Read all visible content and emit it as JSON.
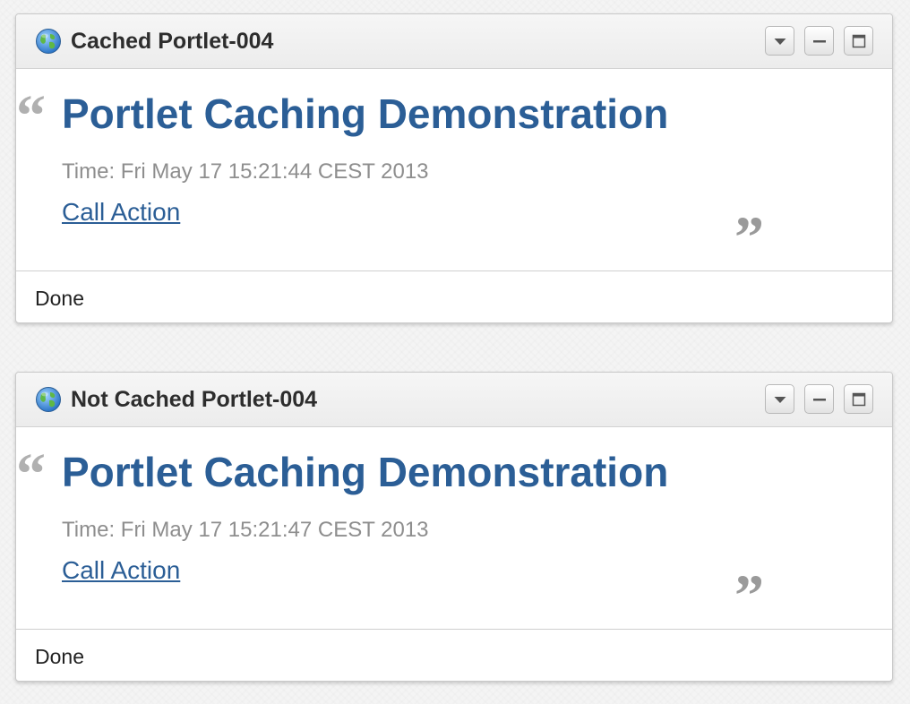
{
  "portlets": [
    {
      "title": "Cached Portlet-004",
      "icon": "globe-icon",
      "controls": [
        "dropdown-icon",
        "minimize-icon",
        "maximize-icon"
      ],
      "heading": "Portlet Caching Demonstration",
      "time": "Time: Fri May 17 15:21:44 CEST 2013",
      "action_label": "Call Action",
      "status": "Done"
    },
    {
      "title": "Not Cached Portlet-004",
      "icon": "globe-icon",
      "controls": [
        "dropdown-icon",
        "minimize-icon",
        "maximize-icon"
      ],
      "heading": "Portlet Caching Demonstration",
      "time": "Time: Fri May 17 15:21:47 CEST 2013",
      "action_label": "Call Action",
      "status": "Done"
    }
  ],
  "colors": {
    "heading": "#2b5e96",
    "link": "#2b5e96",
    "time": "#8e8e8e",
    "quote": "#b0b0b0"
  }
}
